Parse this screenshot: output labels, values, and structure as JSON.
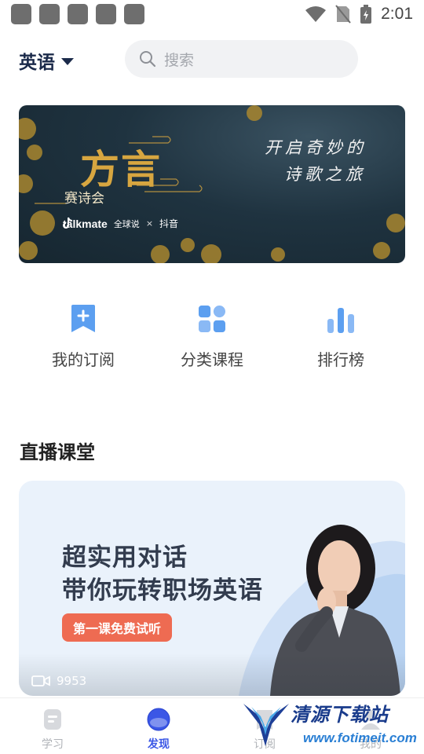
{
  "status_bar": {
    "time": "2:01",
    "icons": [
      "notification-icon",
      "notification-icon",
      "notification-icon",
      "notification-icon",
      "notification-icon",
      "wifi-icon",
      "no-sim-icon",
      "battery-icon"
    ]
  },
  "header": {
    "language": "英语",
    "search_placeholder": "搜索"
  },
  "banner": {
    "title": "方言",
    "subtitle": "赛诗会",
    "tagline_line1": "开启奇妙的",
    "tagline_line2": "诗歌之旅",
    "brand_talkmate": "talkmate",
    "brand_quanqiushuo": "全球说",
    "brand_separator": "×",
    "brand_douyin": "抖音"
  },
  "quick_entries": [
    {
      "label": "我的订阅",
      "icon": "bookmark-plus-icon"
    },
    {
      "label": "分类课程",
      "icon": "grid-icon"
    },
    {
      "label": "排行榜",
      "icon": "bar-chart-icon"
    }
  ],
  "live_section": {
    "title": "直播课堂",
    "card": {
      "headline_line1": "超实用对话",
      "headline_line2": "带你玩转职场英语",
      "cta": "第一课免费试听",
      "views": "9953"
    }
  },
  "bottom_nav": {
    "items": [
      {
        "label": "学习",
        "icon": "study-icon",
        "active": false
      },
      {
        "label": "发现",
        "icon": "discover-icon",
        "active": true
      },
      {
        "label": "订阅",
        "icon": "subscribe-icon",
        "active": false
      },
      {
        "label": "我的",
        "icon": "profile-icon",
        "active": false
      }
    ]
  },
  "watermark": {
    "text": "清源下载站",
    "url": "www.fotimeit.com"
  },
  "colors": {
    "accent": "#3b57e6",
    "icon_blue": "#5c9ff0",
    "cta": "#ee6b52",
    "banner_gold": "#d7a640"
  }
}
